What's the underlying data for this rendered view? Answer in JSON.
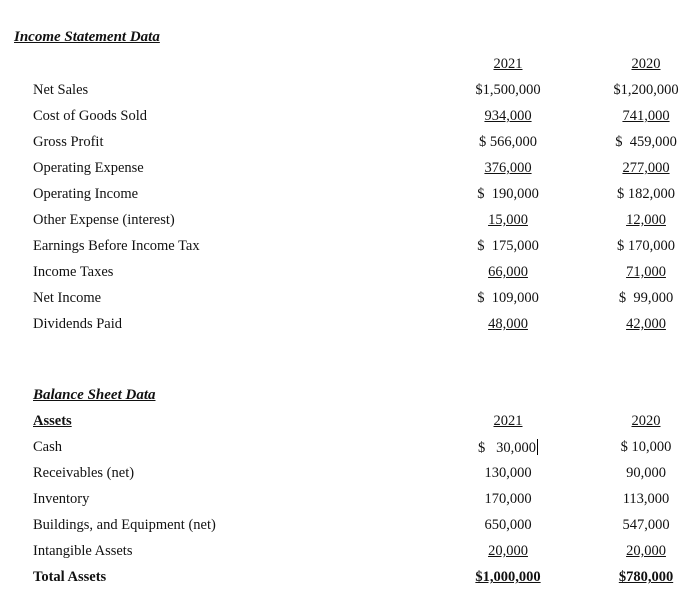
{
  "income_statement": {
    "title": "Income Statement Data",
    "years": [
      "2021",
      "2020"
    ],
    "rows": [
      {
        "label": "Net Sales",
        "v2021": "$1,500,000",
        "v2020": "$1,200,000",
        "underline": false
      },
      {
        "label": "Cost of Goods Sold",
        "v2021": "934,000",
        "v2020": "741,000",
        "underline": true
      },
      {
        "label": "Gross Profit",
        "v2021": "$ 566,000",
        "v2020": "$  459,000",
        "underline": false
      },
      {
        "label": "Operating Expense",
        "v2021": "376,000",
        "v2020": "277,000",
        "underline": true
      },
      {
        "label": "Operating Income",
        "v2021": "$  190,000",
        "v2020": "$ 182,000",
        "underline": false
      },
      {
        "label": "Other Expense (interest)",
        "v2021": "15,000",
        "v2020": "12,000",
        "underline": true
      },
      {
        "label": "Earnings Before Income Tax",
        "v2021": "$  175,000",
        "v2020": "$ 170,000",
        "underline": false
      },
      {
        "label": "Income Taxes",
        "v2021": "66,000",
        "v2020": "71,000",
        "underline": true
      },
      {
        "label": "Net Income",
        "v2021": "$  109,000",
        "v2020": "$  99,000",
        "underline": false
      },
      {
        "label": "Dividends Paid",
        "v2021": "48,000",
        "v2020": "42,000",
        "underline": true
      }
    ]
  },
  "balance_sheet": {
    "title": "Balance Sheet Data",
    "subheading": "Assets",
    "years": [
      "2021",
      "2020"
    ],
    "rows": [
      {
        "label": "Cash",
        "v2021": "$   30,000",
        "v2020": "$ 10,000",
        "underline": false
      },
      {
        "label": "Receivables (net)",
        "v2021": "130,000",
        "v2020": "90,000",
        "underline": false
      },
      {
        "label": "Inventory",
        "v2021": "170,000",
        "v2020": "113,000",
        "underline": false
      },
      {
        "label": "Buildings, and Equipment (net)",
        "v2021": "650,000",
        "v2020": "547,000",
        "underline": false
      },
      {
        "label": "Intangible Assets",
        "v2021": "20,000",
        "v2020": "20,000",
        "underline": true
      },
      {
        "label": "Total Assets",
        "v2021": "$1,000,000",
        "v2020": "$780,000",
        "underline": true,
        "bold": true
      }
    ]
  }
}
